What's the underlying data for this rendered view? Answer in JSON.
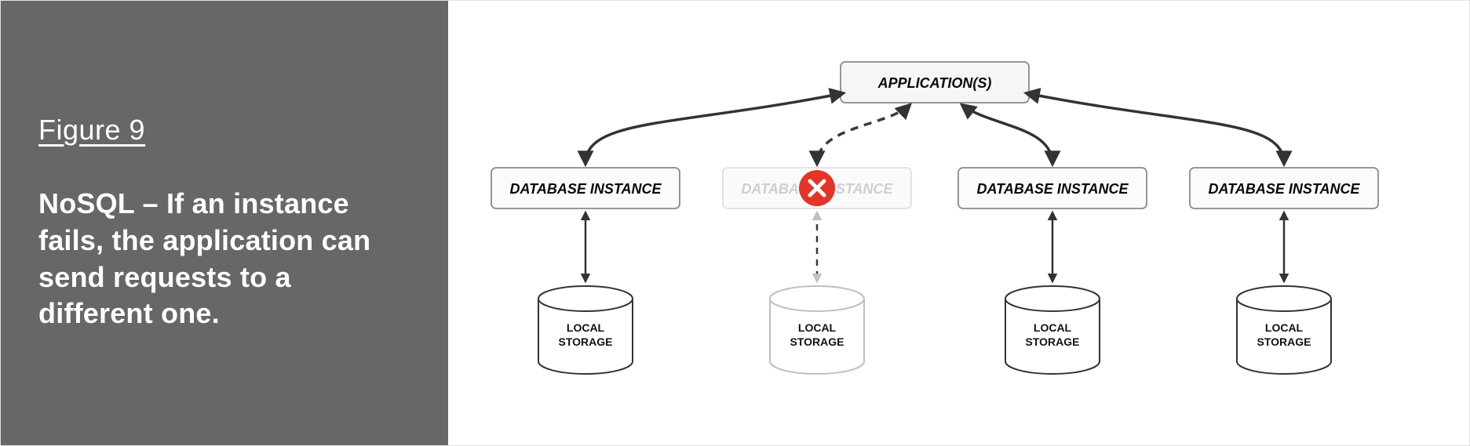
{
  "caption": {
    "label": "Figure 9",
    "description": "NoSQL – If an instance fails, the application can send requests to a different one."
  },
  "diagram": {
    "top_node": "APPLICATION(S)",
    "nodes": [
      {
        "label": "DATABASE INSTANCE",
        "storage_line1": "LOCAL",
        "storage_line2": "STORAGE",
        "failed": false
      },
      {
        "label": "DATABASE INSTANCE",
        "storage_line1": "LOCAL",
        "storage_line2": "STORAGE",
        "failed": true
      },
      {
        "label": "DATABASE INSTANCE",
        "storage_line1": "LOCAL",
        "storage_line2": "STORAGE",
        "failed": false
      },
      {
        "label": "DATABASE INSTANCE",
        "storage_line1": "LOCAL",
        "storage_line2": "STORAGE",
        "failed": false
      }
    ],
    "error_icon": "error-icon"
  }
}
